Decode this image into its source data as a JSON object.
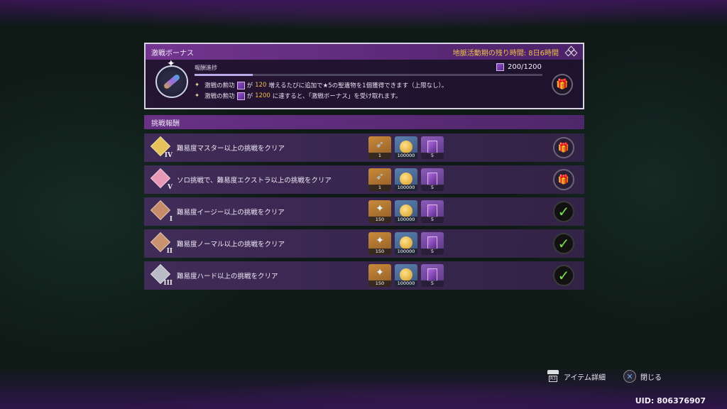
{
  "bonus": {
    "title": "激戦ボーナス",
    "remaining": "地脈活動期の残り時間: 8日6時間",
    "progress_label": "報酬進捗",
    "progress_count": "200/1200",
    "progress_fraction": 0.167,
    "line1_a": "激戦の勲功",
    "line1_b": "が",
    "line1_num": "120",
    "line1_c": "増えるたびに追加で★5の聖遺物を1個獲得できます（上限なし）。",
    "line2_a": "激戦の勲功",
    "line2_b": "が",
    "line2_num": "1200",
    "line2_c": "に達すると、「激戦ボーナス」を受け取れます。",
    "gift_icon": "gift-icon"
  },
  "challenge": {
    "header": "挑戦報酬",
    "rows": [
      {
        "label": "難易度マスター以上の挑戦をクリア",
        "numeral": "IV",
        "emblem_color": "#e6c25a",
        "items": [
          "1",
          "100000",
          "5"
        ],
        "status": "locked"
      },
      {
        "label": "ソロ挑戦で、難易度エクストラ以上の挑戦をクリア",
        "numeral": "V",
        "emblem_color": "#e79ab8",
        "items": [
          "1",
          "100000",
          "5"
        ],
        "status": "locked"
      },
      {
        "label": "難易度イージー以上の挑戦をクリア",
        "numeral": "I",
        "emblem_color": "#c58b6a",
        "items": [
          "150",
          "100000",
          "5"
        ],
        "status": "done"
      },
      {
        "label": "難易度ノーマル以上の挑戦をクリア",
        "numeral": "II",
        "emblem_color": "#c9936f",
        "items": [
          "150",
          "100000",
          "5"
        ],
        "status": "done"
      },
      {
        "label": "難易度ハード以上の挑戦をクリア",
        "numeral": "III",
        "emblem_color": "#b9bcc6",
        "items": [
          "150",
          "100000",
          "5"
        ],
        "status": "done"
      }
    ]
  },
  "footer": {
    "item_detail": "アイテム詳細",
    "r3_label": "R3",
    "close": "閉じる",
    "close_glyph": "✕",
    "uid": "UID: 806376907"
  },
  "colors": {
    "accent": "#f0c04a",
    "check": "#7be04d"
  }
}
